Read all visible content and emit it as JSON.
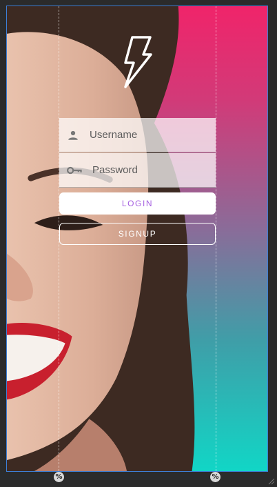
{
  "logo": {
    "icon": "lightning-bolt-icon"
  },
  "form": {
    "username": {
      "icon": "person-icon",
      "placeholder": "Username"
    },
    "password": {
      "icon": "key-icon",
      "placeholder": "Password"
    },
    "login_label": "LOGIN",
    "signup_label": "SIGNUP"
  },
  "guides": {
    "left_marker": "%",
    "right_marker": "%"
  },
  "colors": {
    "gradient_top": "#f0246a",
    "gradient_bottom": "#11d6c6",
    "login_text": "#a55fe0",
    "device_border": "#3d7fd6"
  }
}
